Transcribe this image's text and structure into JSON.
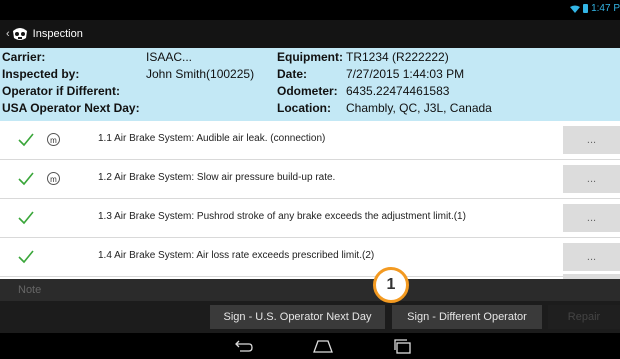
{
  "status": {
    "time": "1:47 P"
  },
  "actionbar": {
    "title": "Inspection"
  },
  "info": {
    "carrier_label": "Carrier:",
    "carrier_value": "ISAAC...",
    "inspected_label": "Inspected by:",
    "inspected_value": "John Smith(100225)",
    "operator_label": "Operator if Different:",
    "usa_label": "USA Operator Next Day:",
    "equipment_label": "Equipment:",
    "equipment_value": "TR1234 (R222222)",
    "date_label": "Date:",
    "date_value": "7/27/2015 1:44:03 PM",
    "odometer_label": "Odometer:",
    "odometer_value": "6435.22474461583",
    "location_label": "Location:",
    "location_value": "Chambly, QC, J3L, Canada"
  },
  "items": [
    {
      "text": "1.1 Air Brake System: Audible air leak. (connection)",
      "m_icon": "m",
      "more": "..."
    },
    {
      "text": "1.2 Air Brake System: Slow air pressure build-up rate.",
      "m_icon": "m",
      "more": "..."
    },
    {
      "text": "1.3 Air Brake System: Pushrod stroke of any brake exceeds the adjustment limit.(1)",
      "more": "..."
    },
    {
      "text": "1.4 Air Brake System: Air loss rate exceeds prescribed limit.(2)",
      "more": "..."
    }
  ],
  "note": {
    "placeholder": "Note"
  },
  "buttons": {
    "sign_us": "Sign - U.S. Operator Next Day",
    "sign_diff": "Sign - Different Operator",
    "repair": "Repair"
  },
  "badge": {
    "number": "1"
  },
  "colors": {
    "check": "#3aa63a",
    "badge_ring": "#f39a21",
    "info_bg": "#c3e8f5"
  }
}
